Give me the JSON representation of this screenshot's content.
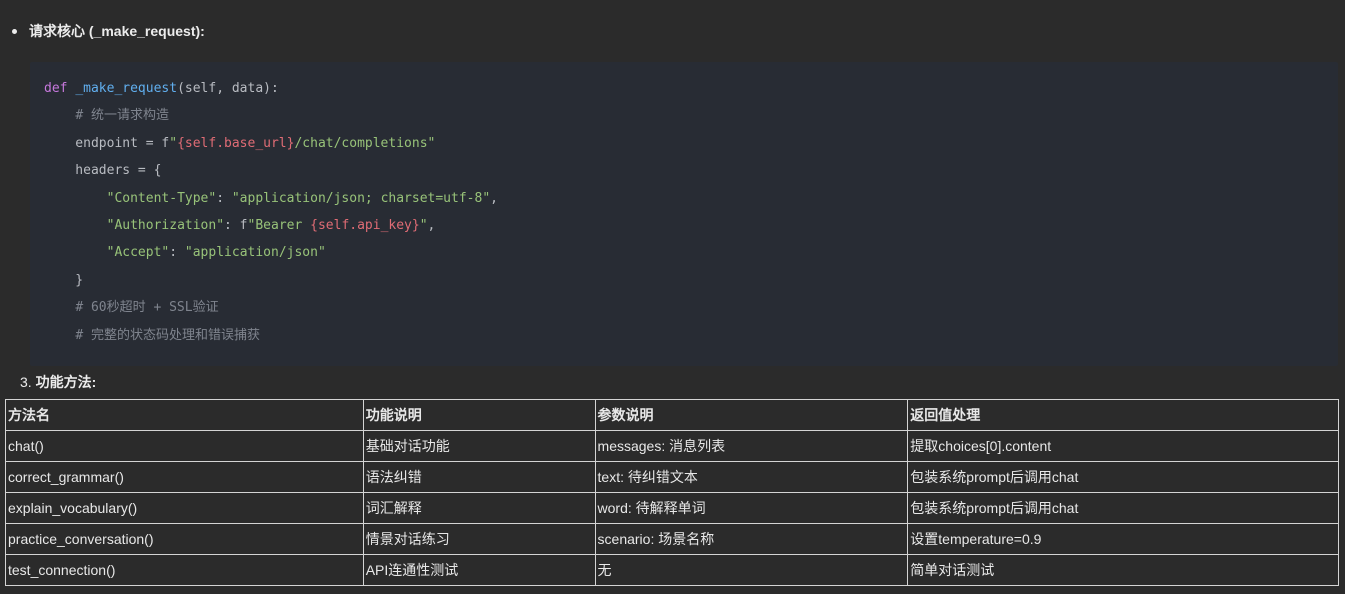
{
  "bullet": {
    "label": "请求核心 (_make_request):"
  },
  "code": {
    "lines": [
      [
        {
          "t": "def",
          "c": "kw"
        },
        {
          "t": " ",
          "c": "plain"
        },
        {
          "t": "_make_request",
          "c": "fn"
        },
        {
          "t": "(self, data):",
          "c": "plain"
        }
      ],
      [
        {
          "t": "    ",
          "c": "plain"
        },
        {
          "t": "# 统一请求构造",
          "c": "cm"
        }
      ],
      [
        {
          "t": "    endpoint = f",
          "c": "plain"
        },
        {
          "t": "\"",
          "c": "str"
        },
        {
          "t": "{self.base_url}",
          "c": "interp"
        },
        {
          "t": "/chat/completions\"",
          "c": "str"
        }
      ],
      [
        {
          "t": "    headers = {",
          "c": "plain"
        }
      ],
      [
        {
          "t": "        ",
          "c": "plain"
        },
        {
          "t": "\"Content-Type\"",
          "c": "str"
        },
        {
          "t": ": ",
          "c": "plain"
        },
        {
          "t": "\"application/json; charset=utf-8\"",
          "c": "str"
        },
        {
          "t": ",",
          "c": "plain"
        }
      ],
      [
        {
          "t": "        ",
          "c": "plain"
        },
        {
          "t": "\"Authorization\"",
          "c": "str"
        },
        {
          "t": ": f",
          "c": "plain"
        },
        {
          "t": "\"Bearer ",
          "c": "str"
        },
        {
          "t": "{self.api_key}",
          "c": "interp"
        },
        {
          "t": "\"",
          "c": "str"
        },
        {
          "t": ",",
          "c": "plain"
        }
      ],
      [
        {
          "t": "        ",
          "c": "plain"
        },
        {
          "t": "\"Accept\"",
          "c": "str"
        },
        {
          "t": ": ",
          "c": "plain"
        },
        {
          "t": "\"application/json\"",
          "c": "str"
        }
      ],
      [
        {
          "t": "    }",
          "c": "plain"
        }
      ],
      [
        {
          "t": "    ",
          "c": "plain"
        },
        {
          "t": "# 60秒超时 + SSL验证",
          "c": "cm"
        }
      ],
      [
        {
          "t": "    ",
          "c": "plain"
        },
        {
          "t": "# 完整的状态码处理和错误捕获",
          "c": "cm"
        }
      ]
    ]
  },
  "section": {
    "number": "3.",
    "title": "功能方法:"
  },
  "table": {
    "headers": [
      "方法名",
      "功能说明",
      "参数说明",
      "返回值处理"
    ],
    "rows": [
      [
        "chat()",
        "基础对话功能",
        "messages: 消息列表",
        "提取choices[0].content"
      ],
      [
        "correct_grammar()",
        "语法纠错",
        "text: 待纠错文本",
        "包装系统prompt后调用chat"
      ],
      [
        "explain_vocabulary()",
        "词汇解释",
        "word: 待解释单词",
        "包装系统prompt后调用chat"
      ],
      [
        "practice_conversation()",
        "情景对话练习",
        "scenario: 场景名称",
        "设置temperature=0.9"
      ],
      [
        "test_connection()",
        "API连通性测试",
        "无",
        "简单对话测试"
      ]
    ]
  }
}
